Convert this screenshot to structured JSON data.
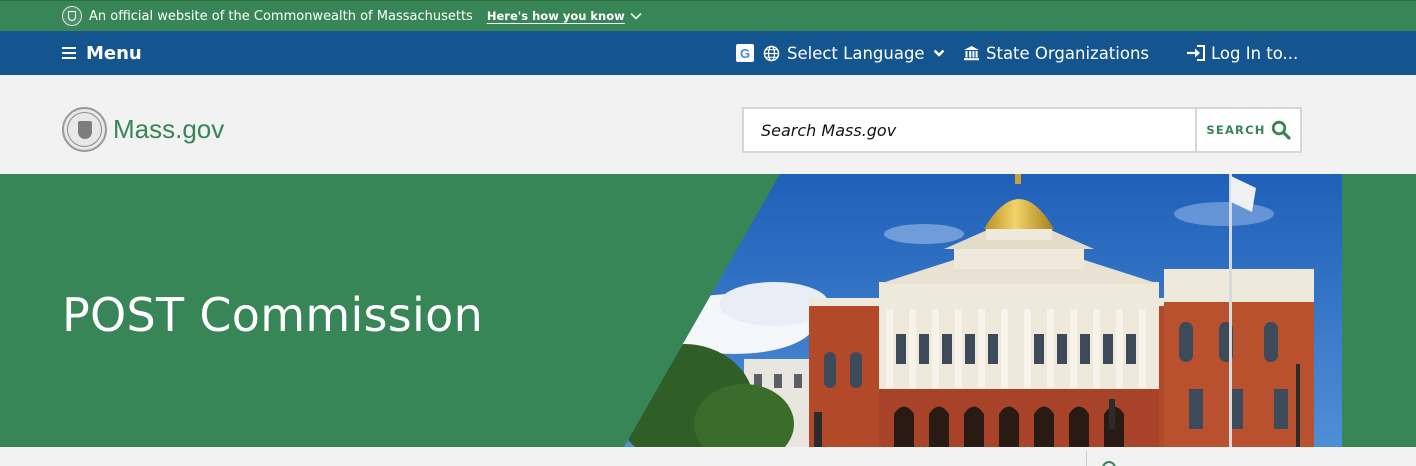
{
  "official_bar": {
    "text": "An official website of the Commonwealth of Massachusetts",
    "link_label": "Here's how you know",
    "icons": [
      "seal-icon",
      "chevron-down-icon"
    ]
  },
  "utility_nav": {
    "menu_label": "Menu",
    "language_label": "Select Language",
    "orgs_label": "State Organizations",
    "login_label": "Log In to...",
    "google_letter": "G",
    "icons": [
      "hamburger-icon",
      "google-icon",
      "globe-icon",
      "caret-down-icon",
      "building-icon",
      "login-icon"
    ]
  },
  "header": {
    "logo_text": "Mass.gov",
    "search_placeholder": "Search Mass.gov",
    "search_button": "SEARCH",
    "icons": [
      "seal-icon",
      "search-icon"
    ]
  },
  "hero": {
    "title": "POST Commission",
    "image": "massachusetts-state-house-photo"
  },
  "colors": {
    "green": "#388557",
    "blue": "#14558f",
    "gold": "#d9b23a",
    "brick": "#b24a2a",
    "sky": "#2d6fc0",
    "background": "#f2f2f2"
  }
}
